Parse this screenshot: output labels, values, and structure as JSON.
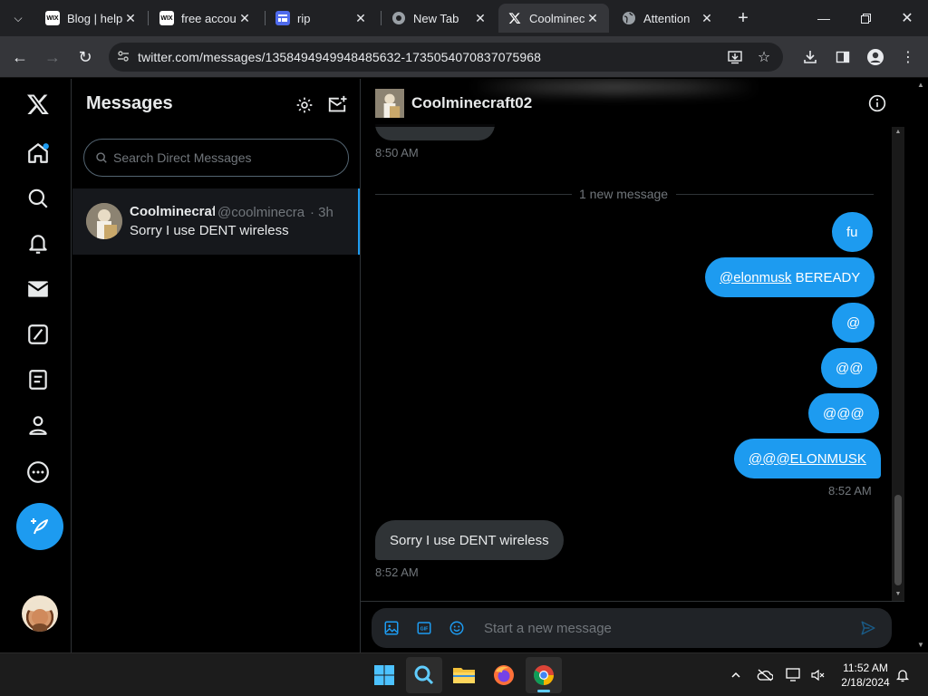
{
  "browser": {
    "tabs": [
      {
        "title": "Blog | help",
        "icon": "wix",
        "active": false
      },
      {
        "title": "free accou",
        "icon": "wix",
        "active": false
      },
      {
        "title": "rip",
        "icon": "form",
        "active": false
      },
      {
        "title": "New Tab",
        "icon": "chrome",
        "active": false
      },
      {
        "title": "Coolminec",
        "icon": "x",
        "active": true
      },
      {
        "title": "Attention",
        "icon": "globe",
        "active": false
      }
    ],
    "url": "twitter.com/messages/1358494949948485632-1735054070837075968"
  },
  "leftnav": {
    "items": [
      "x-logo",
      "home",
      "explore",
      "notifications",
      "messages",
      "grok",
      "lists",
      "profile",
      "more"
    ]
  },
  "conversations": {
    "title": "Messages",
    "search_placeholder": "Search Direct Messages",
    "items": [
      {
        "name": "Coolminecraf",
        "handle": "@coolminecra",
        "time": "· 3h",
        "preview": "Sorry I use DENT wireless"
      }
    ]
  },
  "chat": {
    "name": "Coolminecraft02",
    "earlier_time": "8:50 AM",
    "divider": "1 new message",
    "outgoing": [
      {
        "text": "fu"
      },
      {
        "mention": "@elonmusk",
        "text": " BEREADY"
      },
      {
        "text": "@"
      },
      {
        "text": "@@"
      },
      {
        "text": "@@@"
      },
      {
        "mention": "@@@ELONMUSK",
        "text": ""
      }
    ],
    "outgoing_time": "8:52 AM",
    "incoming": {
      "text": "Sorry I use DENT wireless",
      "time": "8:52 AM"
    },
    "composer_placeholder": "Start a new message"
  },
  "taskbar": {
    "time": "11:52 AM",
    "date": "2/18/2024"
  },
  "colors": {
    "accent": "#1d9bf0",
    "background": "#000000",
    "bubble_in": "#2f3336",
    "muted": "#71767b"
  }
}
